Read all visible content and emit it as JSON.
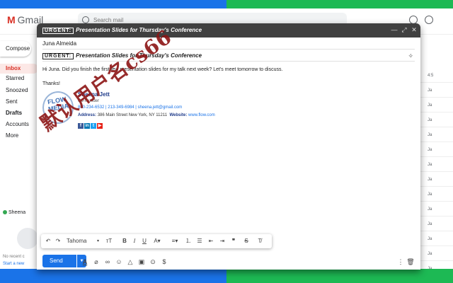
{
  "gmail": {
    "logo_text": "Gmail",
    "search_placeholder": "Search mail",
    "compose_label": "Compose",
    "sidebar": [
      "Inbox",
      "Starred",
      "Snoozed",
      "Sent",
      "Drafts",
      "Accounts",
      "More"
    ],
    "hangout_user": "Sheena",
    "no_recent": "No recent c",
    "start_new": "Start a new",
    "list_dates": [
      "4:5",
      "Ja",
      "Ja",
      "Ja",
      "Ja",
      "Ja",
      "Ja",
      "Ja",
      "Ja",
      "Ja",
      "Ja",
      "Ja",
      "Ja",
      "Ja"
    ]
  },
  "compose": {
    "title_tag": "URGENT:",
    "title_text": "Presentation Slides for Thursday's Conference",
    "to": "Juna Almeida",
    "subject_tag": "URGENT:",
    "subject_text": "Presentation Slides for Thursday's Conference",
    "body_line1": "Hi Juna. Did you finish the first few presentation slides for my talk next week? Let's meet tomorrow to discuss.",
    "body_line2": "Thanks!",
    "signature": {
      "logo_text": "FLOW MEDIA",
      "name": "Sheena Jett",
      "role": "Co-founder",
      "phone": "800-234-6532 | 213-349-6984 | sheena.jett@gmail.com",
      "address_label": "Address:",
      "address": "386 Main Street New York, NY 11211",
      "website_label": "Website:",
      "website": "www.flow.com"
    },
    "watermark": "默认用户名cs66"
  },
  "toolbar": {
    "font": "Tahoma",
    "send_label": "Send"
  },
  "colors": {
    "accent": "#1a73e8",
    "title_bar": "#404040",
    "bg_left": "#1a73e8",
    "bg_right": "#1db954"
  }
}
